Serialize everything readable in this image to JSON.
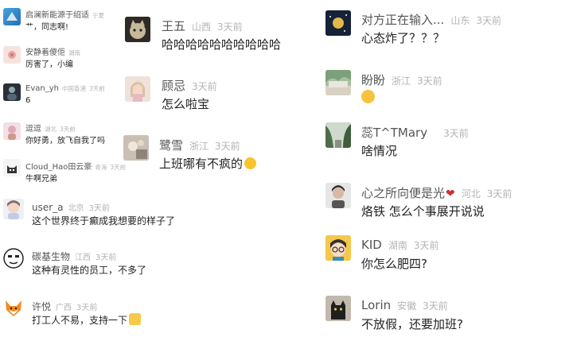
{
  "colors": {
    "name": "#555555",
    "meta": "#b3b3b3",
    "text": "#222222"
  },
  "comments": [
    {
      "name": "启澜新能源于绍适",
      "loc": "宁夏",
      "time": "",
      "text": "艹，同志啊!"
    },
    {
      "name": "安静着傻佢",
      "loc": "湖南",
      "time": "3天前",
      "text": "厉害了，小编"
    },
    {
      "name": "Evan_yh",
      "loc": "中国香港",
      "time": "3天前",
      "text": "6"
    },
    {
      "name": "逗逗",
      "loc": "湖北",
      "time": "3天前",
      "text": "你好勇，放飞自我了吗"
    },
    {
      "name": "Cloud_Hao田云豪",
      "loc": "青海",
      "time": "3天前",
      "text": "牛啊兄弟"
    },
    {
      "name": "user_a",
      "loc": "北京",
      "time": "3天前",
      "text": "这个世界终于癫成我想要的样子了"
    },
    {
      "name": "碳基生物",
      "loc": "江西",
      "time": "3天前",
      "text": "这种有灵性的员工，不多了"
    },
    {
      "name": "许悦",
      "loc": "广西",
      "time": "3天前",
      "text": "打工人不易，支持一下",
      "emoji": "cat-face-emoji"
    },
    {
      "name": "王五",
      "loc": "山西",
      "time": "3天前",
      "text": "哈哈哈哈哈哈哈哈哈哈"
    },
    {
      "name": "顾忌",
      "loc": "",
      "time": "3天前",
      "text": "怎么啦宝"
    },
    {
      "name": "鹭雪",
      "loc": "浙江",
      "time": "3天前",
      "text": "上班哪有不疯的",
      "emoji": "crazy-face-emoji"
    },
    {
      "name": "对方正在输入...",
      "loc": "山东",
      "time": "3天前",
      "text": "心态炸了？？？"
    },
    {
      "name": "盼盼",
      "loc": "浙江",
      "time": "3天前",
      "text": "",
      "emoji": "zipper-mouth-emoji"
    },
    {
      "name": "蕊T^TMary",
      "loc": "",
      "time": "3天前",
      "text": "啥情况"
    },
    {
      "name": "心之所向便是光",
      "loc": "河北",
      "time": "3天前",
      "text": "烙铁 怎么个事展开说说",
      "emoji": "broken-heart-emoji"
    },
    {
      "name": "KID",
      "loc": "湖南",
      "time": "3天前",
      "text": "你怎么肥四?"
    },
    {
      "name": "Lorin",
      "loc": "安徽",
      "time": "3天前",
      "text": "不放假，还要加班?"
    }
  ]
}
